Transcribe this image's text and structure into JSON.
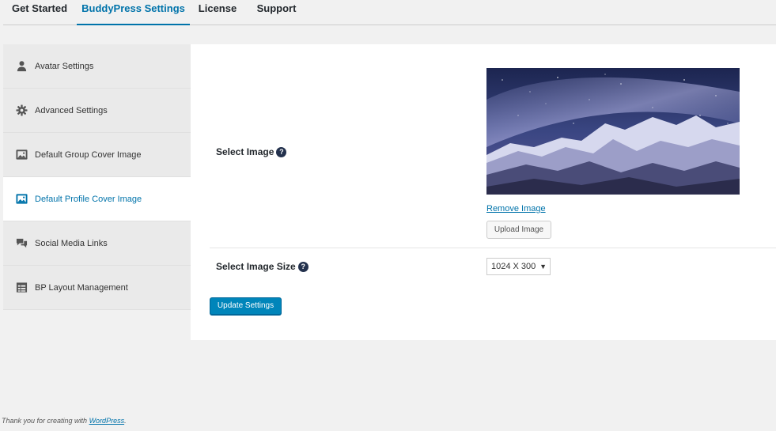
{
  "tabs": [
    {
      "label": "Get Started"
    },
    {
      "label": "BuddyPress Settings"
    },
    {
      "label": "License"
    },
    {
      "label": "Support"
    }
  ],
  "active_tab": "BuddyPress Settings",
  "sidebar": {
    "items": [
      {
        "label": "Avatar Settings",
        "icon": "person-icon"
      },
      {
        "label": "Advanced Settings",
        "icon": "gear-icon"
      },
      {
        "label": "Default Group Cover Image",
        "icon": "image-icon"
      },
      {
        "label": "Default Profile Cover Image",
        "icon": "image-icon"
      },
      {
        "label": "Social Media Links",
        "icon": "chat-bubbles-icon"
      },
      {
        "label": "BP Layout Management",
        "icon": "table-icon"
      }
    ],
    "active_item": "Default Profile Cover Image"
  },
  "form": {
    "select_image_label": "Select Image",
    "remove_image_label": "Remove Image",
    "upload_image_label": "Upload Image",
    "select_image_size_label": "Select Image Size",
    "image_size_value": "1024 X 300",
    "update_button_label": "Update Settings",
    "help_glyph": "?"
  },
  "footer": {
    "prefix": "Thank you for creating with ",
    "link": "WordPress",
    "suffix": "."
  },
  "colors": {
    "accent": "#0073aa",
    "button_primary": "#0085ba",
    "background": "#f1f1f1"
  }
}
